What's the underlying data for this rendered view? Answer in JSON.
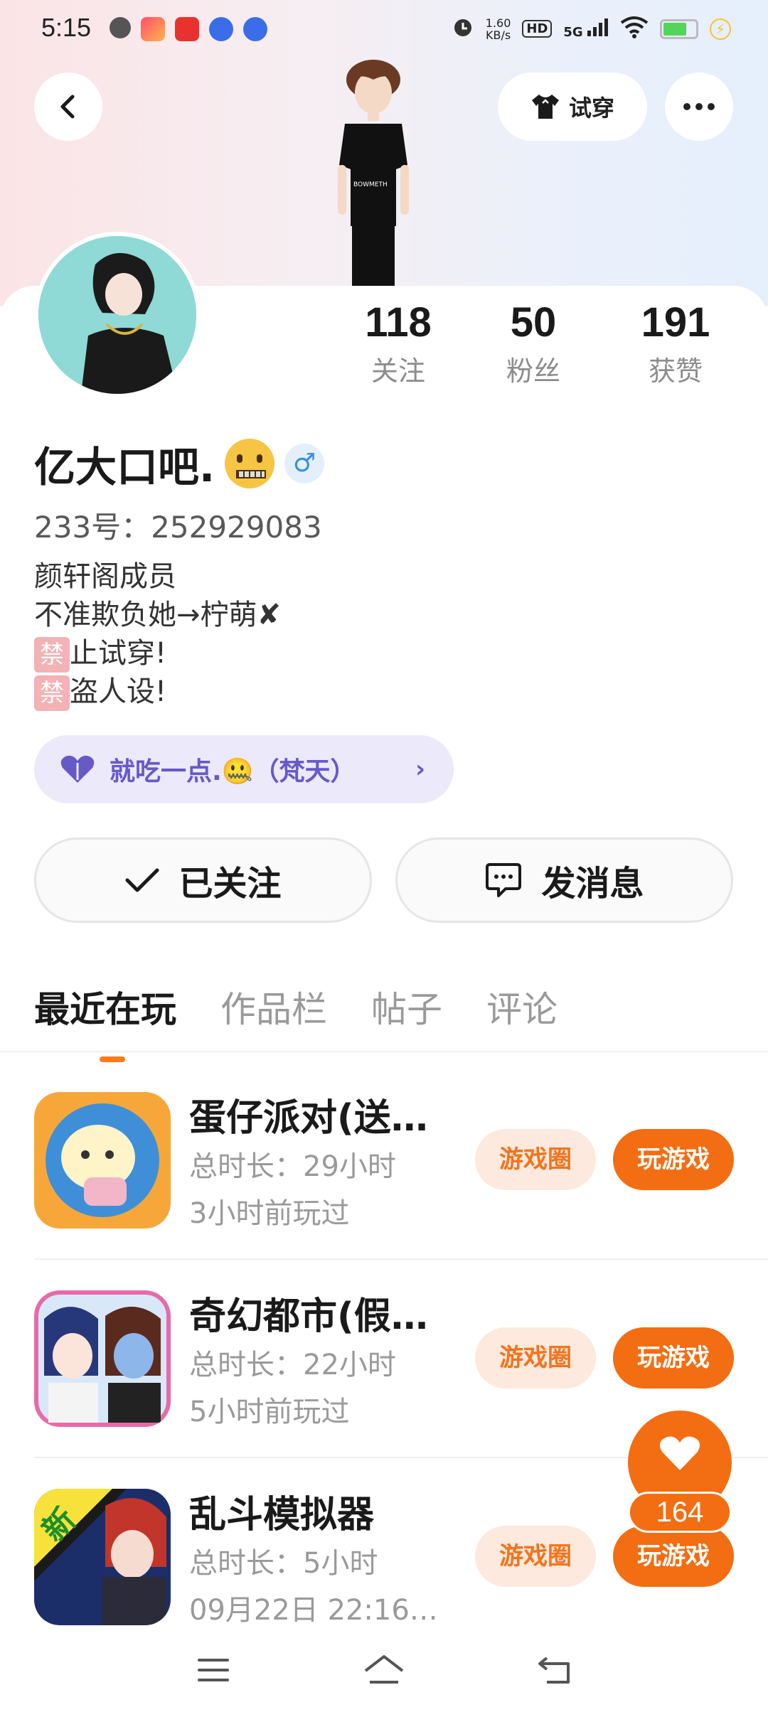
{
  "status_bar": {
    "time": "5:15",
    "net_speed_value": "1.60",
    "net_speed_unit": "KB/s",
    "hd": "HD",
    "signal": "5G"
  },
  "header": {
    "tryon_label": "试穿"
  },
  "profile": {
    "name": "亿大口吧.",
    "gender_symbol": "♂",
    "id_line": "233号：252929083",
    "bio": [
      "颜轩阁成员",
      "不准欺负她→柠萌✘"
    ],
    "bio_ban_char": "禁",
    "bio_ban_lines": [
      "止试穿!",
      "盗人设!"
    ],
    "partner_label": "就吃一点.🤐（梵天）"
  },
  "stats": [
    {
      "value": "118",
      "label": "关注"
    },
    {
      "value": "50",
      "label": "粉丝"
    },
    {
      "value": "191",
      "label": "获赞"
    }
  ],
  "actions": {
    "followed_label": "已关注",
    "message_label": "发消息"
  },
  "tabs": [
    {
      "label": "最近在玩",
      "active": true
    },
    {
      "label": "作品栏",
      "active": false
    },
    {
      "label": "帖子",
      "active": false
    },
    {
      "label": "评论",
      "active": false
    }
  ],
  "games": [
    {
      "title": "蛋仔派对(送…",
      "duration": "总时长：29小时",
      "last_played": "3小时前玩过",
      "circle_label": "游戏圈",
      "play_label": "玩游戏"
    },
    {
      "title": "奇幻都市(假…",
      "duration": "总时长：22小时",
      "last_played": "5小时前玩过",
      "circle_label": "游戏圈",
      "play_label": "玩游戏"
    },
    {
      "title": "乱斗模拟器",
      "duration": "总时长：5小时",
      "last_played": "09月22日 22:16…",
      "circle_label": "游戏圈",
      "play_label": "玩游戏",
      "new_badge": "新"
    }
  ],
  "fab": {
    "like_count": "164"
  },
  "colors": {
    "accent": "#f36d12",
    "partner_bg": "#ece9fb",
    "partner_text": "#6659c8"
  }
}
